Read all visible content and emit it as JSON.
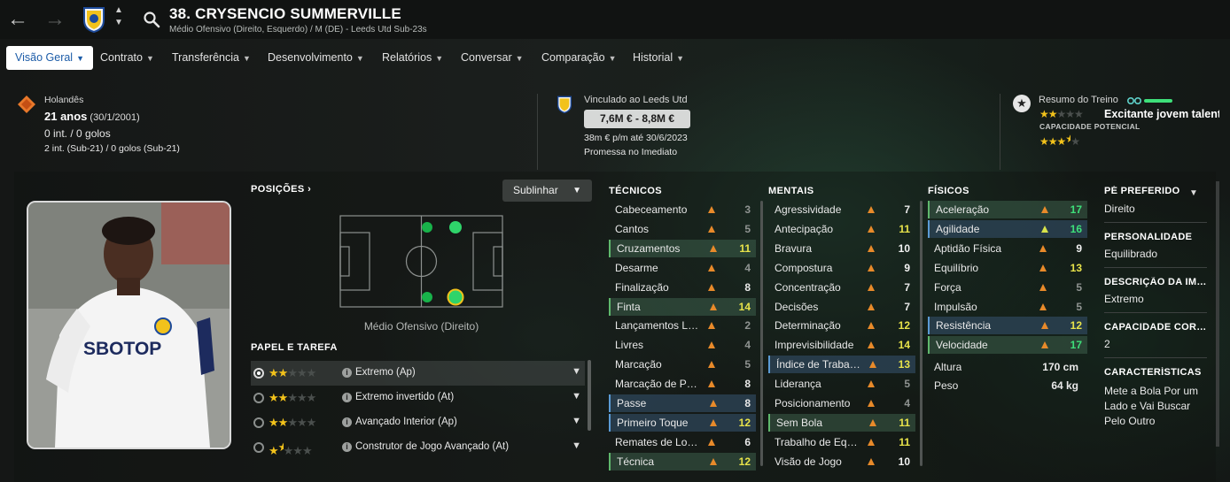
{
  "header": {
    "title": "38. CRYSENCIO SUMMERVILLE",
    "subtitle": "Médio Ofensivo (Direito, Esquerdo) / M (DE) - Leeds Utd Sub-23s",
    "back_icon": "arrow-left-icon",
    "forward_icon": "arrow-right-icon",
    "club_crest": "leeds-crest-icon",
    "search_icon": "search-icon"
  },
  "menu": [
    {
      "label": "Visão Geral",
      "active": true
    },
    {
      "label": "Contrato"
    },
    {
      "label": "Transferência"
    },
    {
      "label": "Desenvolvimento"
    },
    {
      "label": "Relatórios"
    },
    {
      "label": "Conversar"
    },
    {
      "label": "Comparação"
    },
    {
      "label": "Historial"
    }
  ],
  "info": {
    "nationality": "Holandês",
    "age": "21 anos",
    "dob": "(30/1/2001)",
    "caps": "0 int. / 0 golos",
    "caps_u21": "2 int. (Sub-21) / 0 golos (Sub-21)",
    "contract_club": "Vinculado ao Leeds Utd",
    "value": "7,6M € - 8,8M €",
    "wage": "38m € p/m até 30/6/2023",
    "status": "Promessa no Imediato",
    "training_label": "Resumo do Treino",
    "training_summary": "Excitante jovem talento",
    "current_ability_stars": 2,
    "potential_label": "CAPACIDADE POTENCIAL",
    "potential_stars": 3.5
  },
  "positions": {
    "header": "POSIÇÕES",
    "highlight_button": "Sublinhar",
    "position_label": "Médio Ofensivo (Direito)"
  },
  "roles": {
    "header": "PAPEL E TAREFA",
    "items": [
      {
        "name": "Extremo (Ap)",
        "stars": 2,
        "selected": true
      },
      {
        "name": "Extremo invertido (At)",
        "stars": 2
      },
      {
        "name": "Avançado Interior (Ap)",
        "stars": 2
      },
      {
        "name": "Construtor de Jogo Avançado (At)",
        "stars": 1.5
      }
    ]
  },
  "technical": {
    "header": "TÉCNICOS",
    "attrs": [
      {
        "name": "Cabeceamento",
        "value": "3",
        "hl": ""
      },
      {
        "name": "Cantos",
        "value": "5",
        "hl": ""
      },
      {
        "name": "Cruzamentos",
        "value": "11",
        "hl": "g"
      },
      {
        "name": "Desarme",
        "value": "4",
        "hl": ""
      },
      {
        "name": "Finalização",
        "value": "8",
        "hl": ""
      },
      {
        "name": "Finta",
        "value": "14",
        "hl": "g"
      },
      {
        "name": "Lançamentos Longos",
        "value": "2",
        "hl": ""
      },
      {
        "name": "Livres",
        "value": "4",
        "hl": ""
      },
      {
        "name": "Marcação",
        "value": "5",
        "hl": ""
      },
      {
        "name": "Marcação de Penáltis",
        "value": "8",
        "hl": ""
      },
      {
        "name": "Passe",
        "value": "8",
        "hl": "b"
      },
      {
        "name": "Primeiro Toque",
        "value": "12",
        "hl": "b"
      },
      {
        "name": "Remates de Longe",
        "value": "6",
        "hl": ""
      },
      {
        "name": "Técnica",
        "value": "12",
        "hl": "g"
      }
    ]
  },
  "mental": {
    "header": "MENTAIS",
    "attrs": [
      {
        "name": "Agressividade",
        "value": "7",
        "hl": ""
      },
      {
        "name": "Antecipação",
        "value": "11",
        "hl": ""
      },
      {
        "name": "Bravura",
        "value": "10",
        "hl": ""
      },
      {
        "name": "Compostura",
        "value": "9",
        "hl": ""
      },
      {
        "name": "Concentração",
        "value": "7",
        "hl": ""
      },
      {
        "name": "Decisões",
        "value": "7",
        "hl": ""
      },
      {
        "name": "Determinação",
        "value": "12",
        "hl": ""
      },
      {
        "name": "Imprevisibilidade",
        "value": "14",
        "hl": ""
      },
      {
        "name": "Índice de Trabalho",
        "value": "13",
        "hl": "b"
      },
      {
        "name": "Liderança",
        "value": "5",
        "hl": ""
      },
      {
        "name": "Posicionamento",
        "value": "4",
        "hl": ""
      },
      {
        "name": "Sem Bola",
        "value": "11",
        "hl": "g"
      },
      {
        "name": "Trabalho de Equipa",
        "value": "11",
        "hl": ""
      },
      {
        "name": "Visão de Jogo",
        "value": "10",
        "hl": ""
      }
    ]
  },
  "physical": {
    "header": "FÍSICOS",
    "attrs": [
      {
        "name": "Aceleração",
        "value": "17",
        "hl": "g"
      },
      {
        "name": "Agilidade",
        "value": "16",
        "hl": "b"
      },
      {
        "name": "Aptidão Física",
        "value": "9",
        "hl": ""
      },
      {
        "name": "Equilíbrio",
        "value": "13",
        "hl": ""
      },
      {
        "name": "Força",
        "value": "5",
        "hl": ""
      },
      {
        "name": "Impulsão",
        "value": "5",
        "hl": ""
      },
      {
        "name": "Resistência",
        "value": "12",
        "hl": "b"
      },
      {
        "name": "Velocidade",
        "value": "17",
        "hl": "g"
      }
    ],
    "height_label": "Altura",
    "height": "170 cm",
    "weight_label": "Peso",
    "weight": "64 kg"
  },
  "details": {
    "foot_label": "PÉ PREFERIDO",
    "foot": "Direito",
    "personality_label": "PERSONALIDADE",
    "personality": "Equilibrado",
    "media_label": "DESCRIÇÃO DA IMPRENSA",
    "media": "Extremo",
    "ability_label": "CAPACIDADE CORRENTE",
    "ability": "2",
    "traits_label": "CARACTERÍSTICAS",
    "traits": "Mete a Bola Por um Lado e Vai Buscar Pelo Outro"
  },
  "colors": {
    "accent_blue": "#1c5ca8",
    "highlight_green": "#5fb86c",
    "star_gold": "#f2c21b",
    "value_green": "#3ee07a",
    "value_yellow": "#e8e34a"
  }
}
